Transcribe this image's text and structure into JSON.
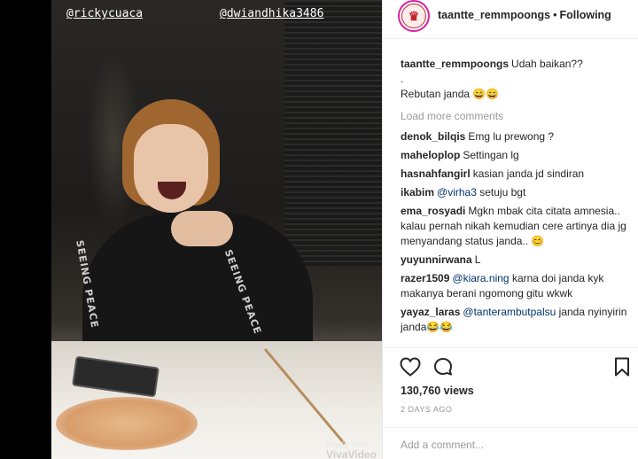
{
  "media": {
    "tag_left": "@rickycuaca",
    "tag_right": "@dwiandhika3486",
    "sleeve_text": "SEEING PEACE",
    "watermark_line1": "Made With",
    "watermark_line2": "VivaVideo"
  },
  "header": {
    "username": "taantte_remmpoongs",
    "separator": "•",
    "following_label": "Following",
    "avatar_icon": "avatar-logo-icon"
  },
  "caption": {
    "username": "taantte_remmpoongs",
    "line1": "Udah baikan??",
    "line2": ".",
    "line3": "Rebutan janda 😄😄"
  },
  "load_more_label": "Load more comments",
  "comments": [
    {
      "user": "denok_bilqis",
      "text": "Emg lu prewong ?"
    },
    {
      "user": "maheloplop",
      "text": "Settingan lg"
    },
    {
      "user": "hasnahfangirl",
      "text": "kasian janda jd sindiran"
    },
    {
      "user": "ikabim",
      "mention": "@virha3",
      "text": "setuju bgt"
    },
    {
      "user": "ema_rosyadi",
      "text": "Mgkn mbak cita citata amnesia.. kalau pernah nikah kemudian cere artinya dia jg menyandang status janda.. 😊"
    },
    {
      "user": "yuyunnirwana",
      "text": "L"
    },
    {
      "user": "razer1509",
      "mention": "@kiara.ning",
      "text": "karna doi janda kyk makanya berani ngomong gitu wkwk"
    },
    {
      "user": "yayaz_laras",
      "mention": "@tanterambutpalsu",
      "text": "janda nyinyirin janda😂😂"
    }
  ],
  "actions": {
    "like_icon": "heart-icon",
    "comment_icon": "comment-icon",
    "save_icon": "bookmark-icon"
  },
  "views": "130,760 views",
  "posted_ago": "2 DAYS AGO",
  "add_comment_placeholder": "Add a comment..."
}
